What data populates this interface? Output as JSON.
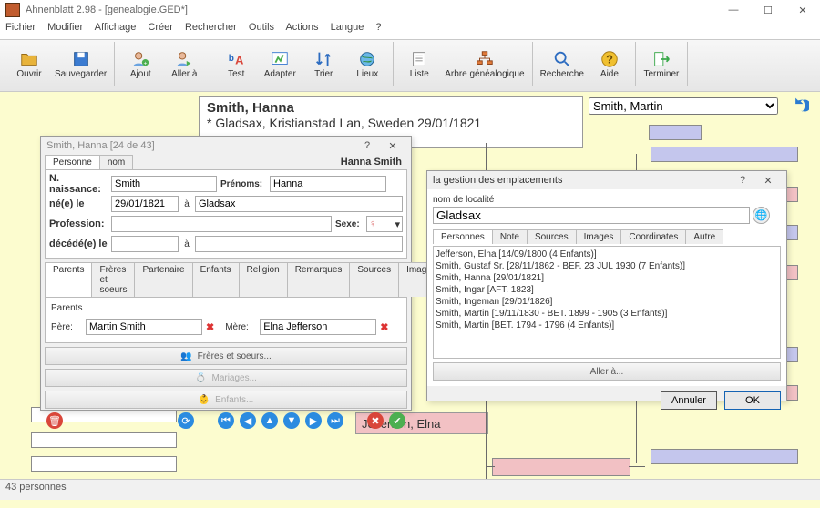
{
  "window": {
    "title": "Ahnenblatt 2.98 - [genealogie.GED*]"
  },
  "menu": [
    "Fichier",
    "Modifier",
    "Affichage",
    "Créer",
    "Rechercher",
    "Outils",
    "Actions",
    "Langue",
    "?"
  ],
  "toolbar": {
    "ouvrir": "Ouvrir",
    "sauvegarder": "Sauvegarder",
    "ajout": "Ajout",
    "aller": "Aller à",
    "test": "Test",
    "adapter": "Adapter",
    "trier": "Trier",
    "lieux": "Lieux",
    "liste": "Liste",
    "arbre": "Arbre généalogique",
    "recherche": "Recherche",
    "aide": "Aide",
    "terminer": "Terminer"
  },
  "summary": {
    "name": "Smith, Hanna",
    "line2": "* Gladsax, Kristianstad Lan, Sweden 29/01/1821"
  },
  "selector": {
    "value": "Smith, Martin"
  },
  "tree": {
    "jefferson": "Jefferson, Elna"
  },
  "person_dialog": {
    "title": "Smith, Hanna [24 de 43]",
    "tabs": {
      "personne": "Personne",
      "nom": "nom"
    },
    "full_name": "Hanna Smith",
    "labels": {
      "nnaissance": "N. naissance:",
      "prenoms": "Prénoms:",
      "ne": "né(e) le",
      "a": "à",
      "profession": "Profession:",
      "sexe": "Sexe:",
      "decede": "décédé(e) le",
      "parents": "Parents",
      "pere": "Père:",
      "mere": "Mère:",
      "freres": "Frères et soeurs...",
      "mariages": "Mariages...",
      "enfants": "Enfants..."
    },
    "values": {
      "surname": "Smith",
      "prenoms": "Hanna",
      "date": "29/01/1821",
      "place": "Gladsax",
      "profession": "",
      "sexe": "",
      "decede_date": "",
      "decede_place": "",
      "pere": "Martin Smith",
      "mere": "Elna Jefferson"
    },
    "subtabs": [
      "Parents",
      "Frères et soeurs",
      "Partenaire",
      "Enfants",
      "Religion",
      "Remarques",
      "Sources",
      "Images"
    ]
  },
  "place_dialog": {
    "title": "la gestion des emplacements",
    "nom_label": "nom de localité",
    "nom_value": "Gladsax",
    "tabs": [
      "Personnes",
      "Note",
      "Sources",
      "Images",
      "Coordinates",
      "Autre"
    ],
    "persons": [
      "Jefferson, Elna [14/09/1800 (4 Enfants)]",
      "Smith, Gustaf Sr. [28/11/1862 - BEF. 23 JUL 1930 (7 Enfants)]",
      "Smith, Hanna [29/01/1821]",
      "Smith, Ingar [AFT. 1823]",
      "Smith, Ingeman [29/01/1826]",
      "Smith, Martin [19/11/1830 - BET. 1899 - 1905 (3 Enfants)]",
      "Smith, Martin [BET. 1794 - 1796 (4 Enfants)]"
    ],
    "aller": "Aller à...",
    "annuler": "Annuler",
    "ok": "OK"
  },
  "status": "43 personnes"
}
